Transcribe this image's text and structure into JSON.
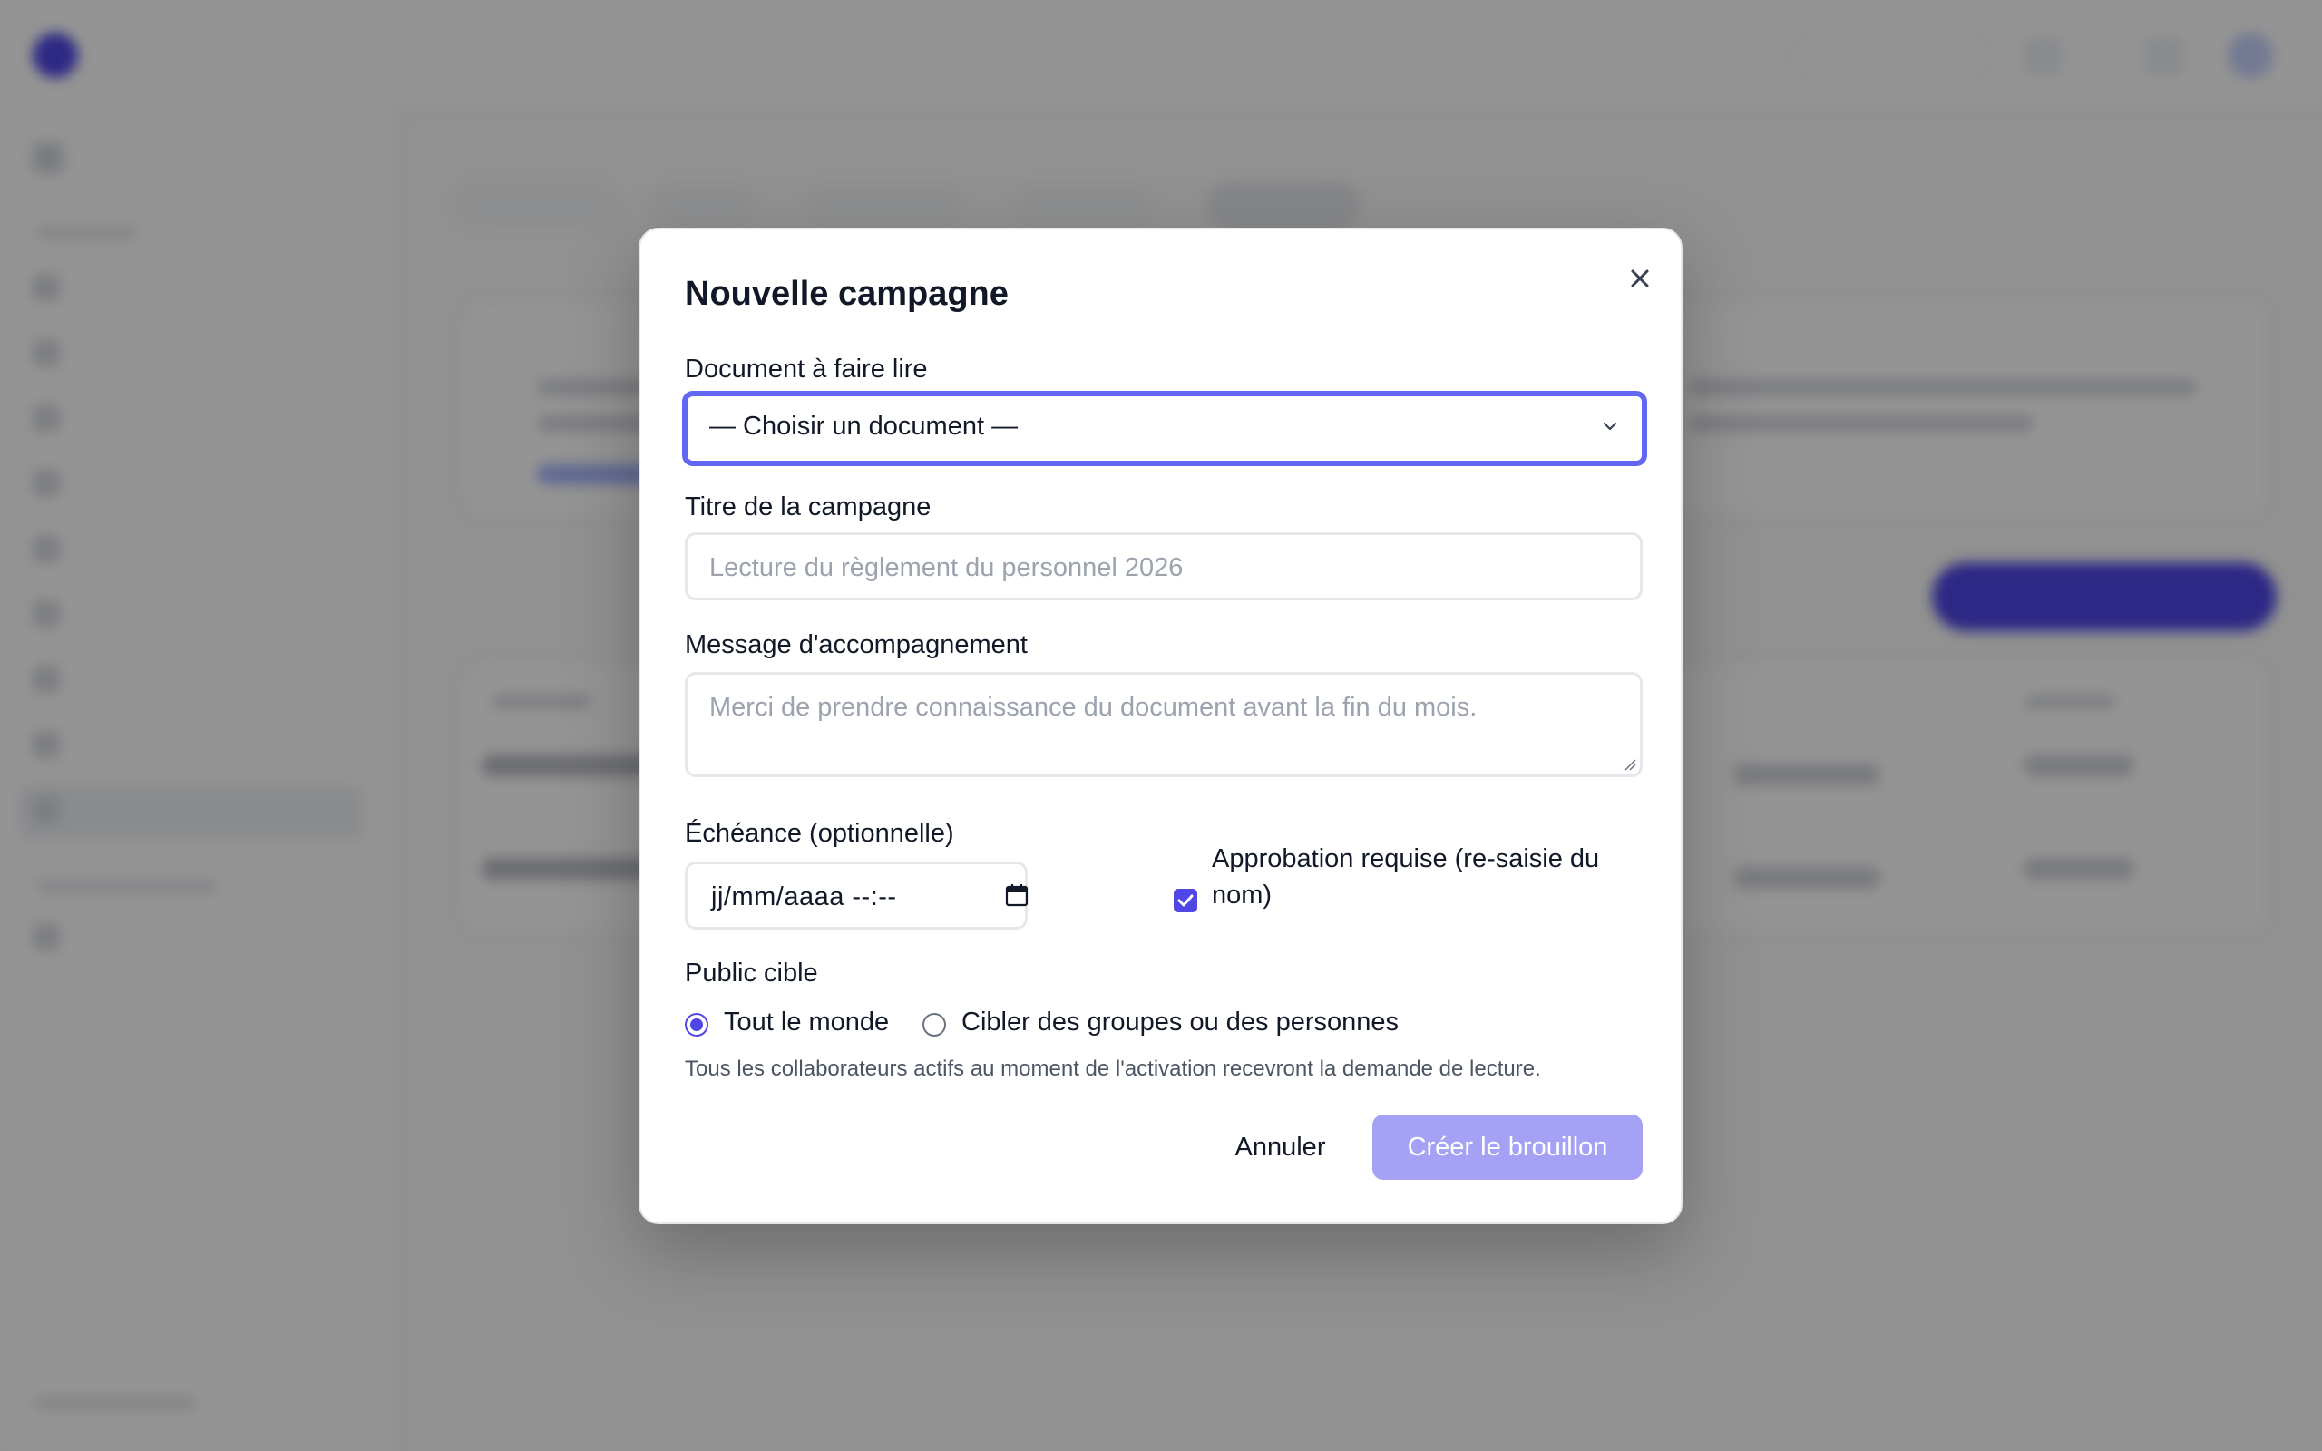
{
  "modal": {
    "title": "Nouvelle campagne",
    "document_label": "Document à faire lire",
    "document_selected": "— Choisir un document —",
    "title_label": "Titre de la campagne",
    "title_placeholder": "Lecture du règlement du personnel 2026",
    "message_label": "Message d'accompagnement",
    "message_placeholder": "Merci de prendre connaissance du document avant la fin du mois.",
    "deadline_label": "Échéance (optionnelle)",
    "deadline_value": "jj/mm/aaaa --:--",
    "approval_label": "Approbation requise (re-saisie du nom)",
    "approval_checked": true,
    "audience_label": "Public cible",
    "audience_options": [
      {
        "label": "Tout le monde",
        "selected": true
      },
      {
        "label": "Cibler des groupes ou des personnes",
        "selected": false
      }
    ],
    "audience_hint": "Tous les collaborateurs actifs au moment de l'activation recevront la demande de lecture.",
    "cancel_label": "Annuler",
    "create_label": "Créer le brouillon"
  },
  "icons": {
    "close": "close-icon",
    "select": "chevron-down-icon",
    "calendar": "calendar-icon",
    "checkbox": "check-icon"
  },
  "colors": {
    "accent": "#4f46e5",
    "focus_ring": "#6366f1",
    "create_button_disabled": "#a5a1f5",
    "overlay": "rgba(0,0,0,0.42)"
  }
}
